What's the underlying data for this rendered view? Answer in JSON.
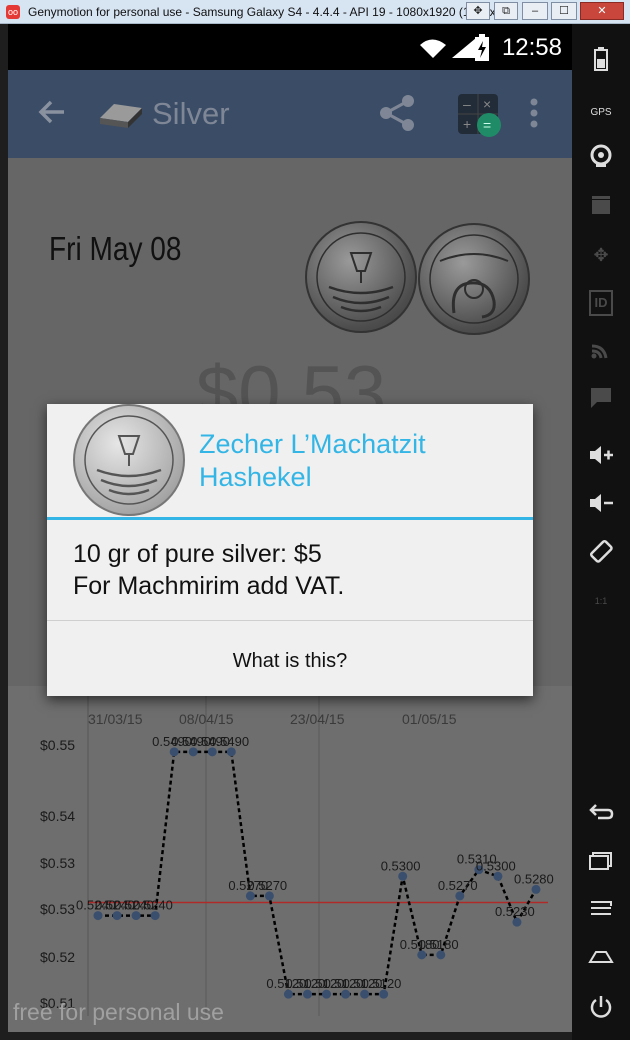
{
  "window": {
    "title": "Genymotion for personal use - Samsung Galaxy S4 - 4.4.4 - API 19 - 1080x1920 (1080x19",
    "logo_text": "oo",
    "btn_min": "–",
    "btn_max": "☐",
    "btn_close": "✕"
  },
  "statusbar": {
    "time": "12:58"
  },
  "appbar": {
    "title": "Silver",
    "back_icon": "arrow-left",
    "share_icon": "share",
    "calc_icon": "calculator",
    "more_icon": "more-vertical"
  },
  "page": {
    "date": "Fri May 08",
    "price": "$0.53"
  },
  "dialog": {
    "title": "Zecher L’Machatzit Hashekel",
    "message_line1": "10 gr of pure silver: $5",
    "message_line2": "For Machmirim add VAT.",
    "button": "What is this?"
  },
  "chart_data": {
    "type": "line",
    "x_tick_labels": [
      "31/03/15",
      "08/04/15",
      "23/04/15",
      "01/05/15"
    ],
    "y_tick_labels": [
      "$0.55",
      "$0.54",
      "$0.53",
      "$0.53",
      "$0.52",
      "$0.51"
    ],
    "series": [
      {
        "values": [
          0.524,
          0.524,
          0.524,
          0.524,
          0.549,
          0.549,
          0.549,
          0.549,
          0.527,
          0.527,
          0.512,
          0.512,
          0.512,
          0.512,
          0.512,
          0.512,
          0.53,
          0.518,
          0.518,
          0.527,
          0.531,
          0.53,
          0.523,
          0.528
        ],
        "labels": [
          "0.5240",
          "0.5240",
          "0.5240",
          "0.5240",
          "0.5490",
          "0.5490",
          "0.5490",
          "0.5490",
          "0.5270",
          "0.5270",
          "0.5120",
          "0.5120",
          "0.5120",
          "0.5120",
          "0.5120",
          "0.5120",
          "0.5300",
          "0.5180",
          "0.5180",
          "0.5270",
          "0.5310",
          "0.5300",
          "0.5230",
          "0.5280"
        ]
      }
    ],
    "reference_line": 0.526,
    "point_color": "#3a4f6e",
    "line_color": "#000000",
    "ref_color": "#b02a2a"
  },
  "watermark": "free for personal use",
  "side_toolbar": {
    "items": [
      "battery-icon",
      "gps-icon",
      "webcam-icon",
      "video-icon",
      "dpad-icon",
      "id-icon",
      "cast-icon",
      "sms-icon",
      "volume-up-icon",
      "volume-down-icon",
      "rotate-icon",
      "scale-icon",
      "back-icon",
      "recent-apps-icon",
      "menu-icon",
      "home-icon",
      "power-icon"
    ],
    "gps_label": "GPS",
    "id_label": "ID",
    "scale_label": "1:1"
  }
}
